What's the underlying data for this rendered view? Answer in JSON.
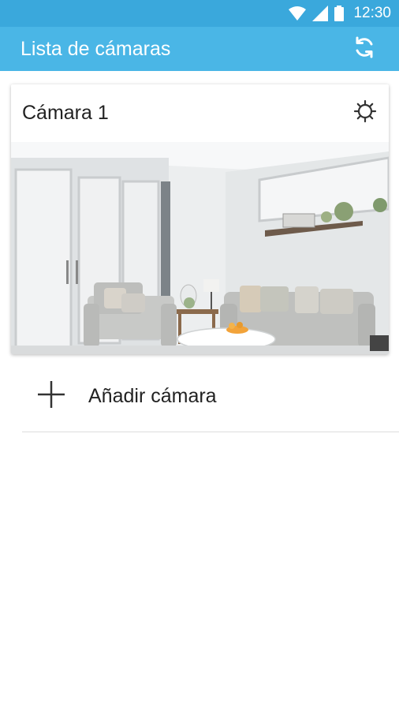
{
  "status_bar": {
    "time": "12:30",
    "icons": [
      "wifi-icon",
      "signal-icon",
      "battery-icon"
    ]
  },
  "app_bar": {
    "title": "Lista de cámaras",
    "refresh_icon": "refresh-icon",
    "color": "#4ab6e6"
  },
  "cameras": [
    {
      "name": "Cámara 1",
      "settings_icon": "gear-icon",
      "preview": "living-room-snapshot"
    }
  ],
  "add_camera": {
    "label": "Añadir cámara",
    "icon": "plus-icon"
  }
}
